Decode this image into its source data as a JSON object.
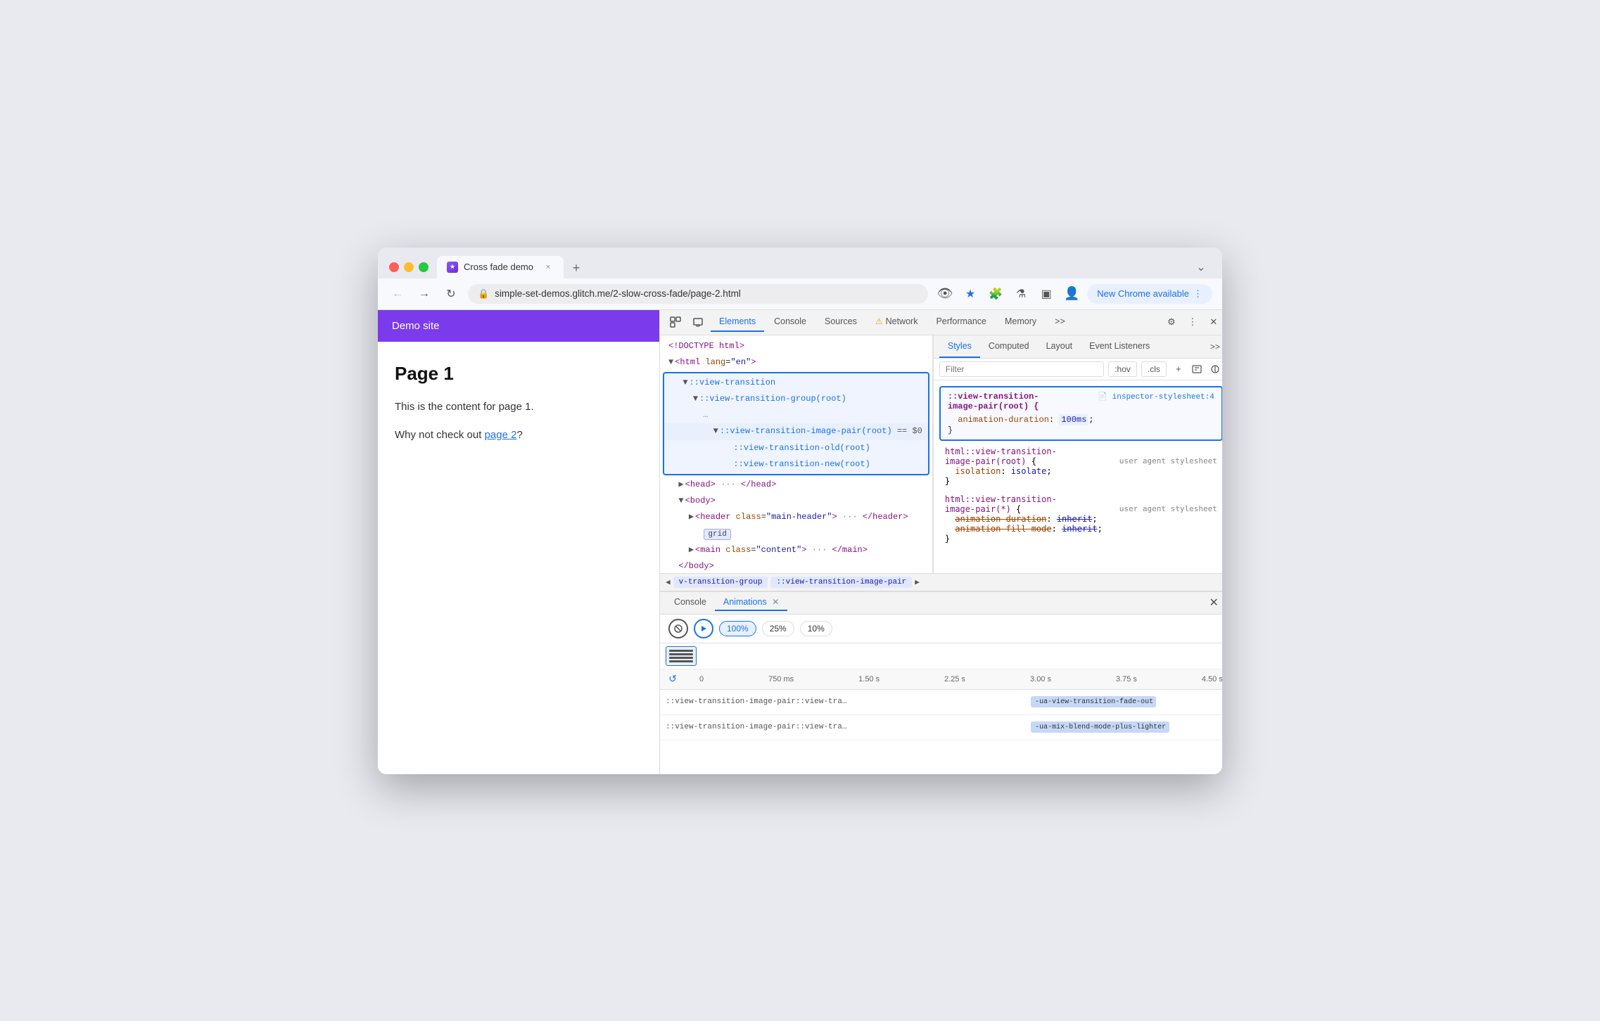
{
  "browser": {
    "tab": {
      "title": "Cross fade demo",
      "favicon_label": "★"
    },
    "address": "simple-set-demos.glitch.me/2-slow-cross-fade/page-2.html",
    "new_chrome_label": "New Chrome available"
  },
  "devtools": {
    "tabs": [
      "Elements",
      "Console",
      "Sources",
      "Network",
      "Performance",
      "Memory",
      ">>"
    ],
    "active_tab": "Elements",
    "network_warning": "Network",
    "styles_tabs": [
      "Styles",
      "Computed",
      "Layout",
      "Event Listeners",
      ">>"
    ],
    "active_styles_tab": "Styles",
    "filter_placeholder": "Filter",
    "hov_label": ":hov",
    "cls_label": ".cls"
  },
  "elements": {
    "lines": [
      {
        "text": "<!DOCTYPE html>",
        "indent": 0
      },
      {
        "text": "<html lang=\"en\">",
        "indent": 0
      },
      {
        "text": "::view-transition",
        "indent": 1,
        "pseudo": true
      },
      {
        "text": "::view-transition-group(root)",
        "indent": 2,
        "pseudo": true
      },
      {
        "text": "...",
        "indent": 2
      },
      {
        "text": "::view-transition-image-pair(root) == $0",
        "indent": 3,
        "pseudo": true
      },
      {
        "text": "::view-transition-old(root)",
        "indent": 4,
        "pseudo": true
      },
      {
        "text": "::view-transition-new(root)",
        "indent": 4,
        "pseudo": true
      },
      {
        "text": "<head> ··· </head>",
        "indent": 1
      },
      {
        "text": "<body>",
        "indent": 1
      },
      {
        "text": "<header class=\"main-header\"> ··· </header>",
        "indent": 2
      },
      {
        "text": "grid",
        "indent": 2,
        "badge": true
      },
      {
        "text": "<main class=\"content\"> ··· </main>",
        "indent": 2
      },
      {
        "text": "</body>",
        "indent": 1
      }
    ]
  },
  "breadcrumb": {
    "items": [
      "v-transition-group",
      "::view-transition-image-pair"
    ]
  },
  "styles": {
    "highlighted_rule": {
      "selector": "::view-transition-image-pair(root) {",
      "source": "inspector-stylesheet:4",
      "properties": [
        {
          "name": "animation-duration",
          "value": "100ms",
          "highlighted": true
        }
      ],
      "close": "}"
    },
    "rules": [
      {
        "selector": "html::view-transition-image-pair(root) {",
        "source": "user agent stylesheet",
        "properties": [
          {
            "name": "isolation",
            "value": "isolate"
          }
        ],
        "close": "}"
      },
      {
        "selector": "html::view-transition-image-pair(*) {",
        "source": "user agent stylesheet",
        "properties": [
          {
            "name": "animation-duration",
            "value": "inherit",
            "strikethrough": true
          },
          {
            "name": "animation-fill-mode",
            "value": "inherit",
            "strikethrough": true
          }
        ],
        "close": "}"
      }
    ]
  },
  "bottom_panel": {
    "tabs": [
      "Console",
      "Animations"
    ],
    "active_tab": "Animations",
    "controls": {
      "pause_label": "⊘",
      "play_label": "▶",
      "speeds": [
        "100%",
        "25%",
        "10%"
      ]
    },
    "timeline": {
      "labels": [
        "0",
        "750 ms",
        "1.50 s",
        "2.25 s",
        "3.00 s",
        "3.75 s",
        "4.50 s"
      ],
      "rows": [
        {
          "label": "::view-transition-image-pair::view-tra…",
          "bar_text": "-ua-view-transition-fade-out"
        },
        {
          "label": "::view-transition-image-pair::view-tra…",
          "bar_text": "-ua-mix-blend-mode-plus-lighter"
        }
      ]
    }
  },
  "demo_site": {
    "header": "Demo site",
    "heading": "Page 1",
    "paragraph1": "This is the content for page 1.",
    "paragraph2_prefix": "Why not check out ",
    "link_text": "page 2",
    "paragraph2_suffix": "?"
  }
}
